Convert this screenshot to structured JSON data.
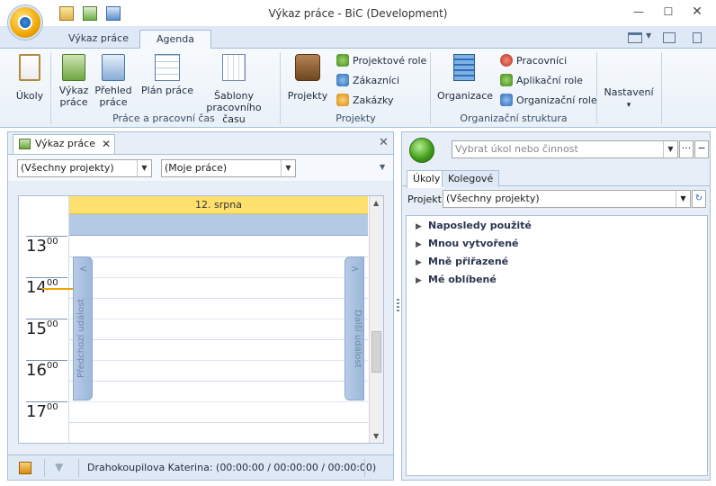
{
  "window": {
    "title": "Výkaz práce - BiC (Development)",
    "minimize": "—",
    "maximize": "☐",
    "close": "✕"
  },
  "tabs": [
    {
      "label": "Výkaz práce"
    },
    {
      "label": "Agenda"
    }
  ],
  "ribbon": {
    "ukoly": "Úkoly",
    "vykaz": "Výkaz práce",
    "prehled": "Přehled práce",
    "plan": "Plán práce",
    "sablony": "Šablony pracovního času",
    "projekty": "Projekty",
    "projektove_role": "Projektové role",
    "zakaznici": "Zákazníci",
    "zakazky": "Zakázky",
    "organizace": "Organizace",
    "pracovnici": "Pracovníci",
    "aplikacni_role": "Aplikační role",
    "organizacni_role": "Organizační role",
    "nastaveni": "Nastavení",
    "nastaveni_caret": "▾",
    "groups": {
      "prace": "Práce a pracovní čas",
      "projekty": "Projekty",
      "org": "Organizační struktura"
    }
  },
  "left_pane": {
    "tab_label": "Výkaz práce",
    "tab_close": "✕",
    "pane_close": "✕",
    "project_filter": "(Všechny projekty)",
    "work_filter": "(Moje práce)",
    "calendar": {
      "day": "12. srpna",
      "hours": [
        "13",
        "14",
        "15",
        "16",
        "17"
      ],
      "minutes": "00",
      "prev_event": "Předchozí událost",
      "next_event": "Další událost",
      "prev_arrow": "<",
      "next_arrow": ">"
    },
    "status": "Drahokoupilova Katerina: (00:00:00 / 00:00:00 / 00:00:00)"
  },
  "right_pane": {
    "task_placeholder": "Vybrat úkol nebo činnost",
    "more": "···",
    "minus": "−",
    "tabs": [
      "Úkoly",
      "Kolegové"
    ],
    "project_label": "Projekt",
    "project_value": "(Všechny projekty)",
    "tree": [
      "Naposledy použité",
      "Mnou vytvořené",
      "Mně přiřazené",
      "Mé oblíbené"
    ]
  }
}
